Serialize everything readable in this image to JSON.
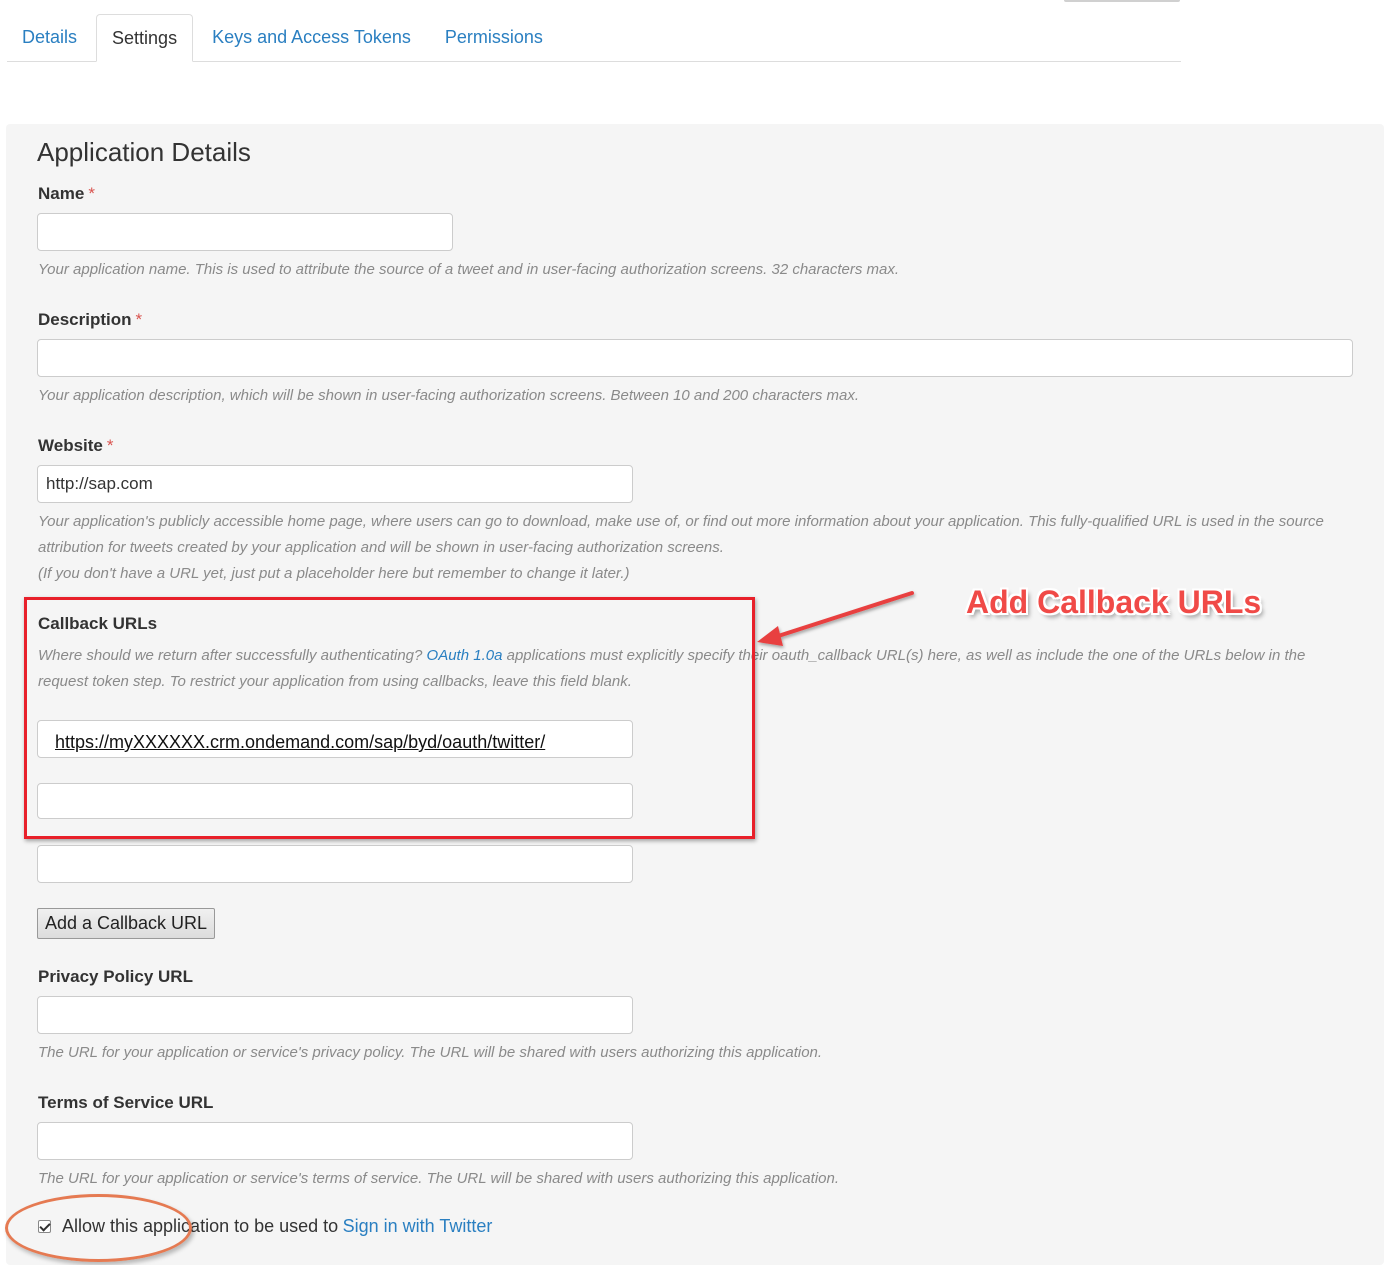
{
  "tabs": [
    {
      "label": "Details",
      "active": false
    },
    {
      "label": "Settings",
      "active": true
    },
    {
      "label": "Keys and Access Tokens",
      "active": false
    },
    {
      "label": "Permissions",
      "active": false
    }
  ],
  "section_title": "Application Details",
  "required_marker": "*",
  "name": {
    "label": "Name",
    "value": "",
    "help": "Your application name. This is used to attribute the source of a tweet and in user-facing authorization screens. 32 characters max."
  },
  "description": {
    "label": "Description",
    "value": "",
    "help": "Your application description, which will be shown in user-facing authorization screens. Between 10 and 200 characters max."
  },
  "website": {
    "label": "Website",
    "value": "http://sap.com",
    "help_line1": "Your application's publicly accessible home page, where users can go to download, make use of, or find out more information about your application. This fully-qualified URL is used in the source",
    "help_line2": "attribution for tweets created by your application and will be shown in user-facing authorization screens.",
    "help_line3": "(If you don't have a URL yet, just put a placeholder here but remember to change it later.)"
  },
  "callback": {
    "label": "Callback URLs",
    "help_pre": "Where should we return after successfully authenticating?",
    "help_link": "OAuth 1.0a",
    "help_post": "applications must explicitly specify their oauth_callback URL(s) here, as well as include the one of the URLs below in the",
    "help_line2": "request token step. To restrict your application from using callbacks, leave this field blank.",
    "url_1": "https://myXXXXXX.crm.ondemand.com/sap/byd/oauth/twitter/",
    "url_2": "",
    "url_3": "",
    "add_button": "Add a Callback URL"
  },
  "privacy": {
    "label": "Privacy Policy URL",
    "value": "",
    "help": "The URL for your application or service's privacy policy. The URL will be shared with users authorizing this application."
  },
  "terms": {
    "label": "Terms of Service URL",
    "value": "",
    "help": "The URL for your application or service's terms of service. The URL will be shared with users authorizing this application."
  },
  "signin": {
    "checked": true,
    "text": "Allow this application to be used to",
    "link": "Sign in with Twitter"
  },
  "annotation": {
    "text": "Add Callback URLs",
    "box_color": "#e8202a",
    "ellipse_color": "#e57a52"
  },
  "colors": {
    "link": "#2a7fc1",
    "panel_bg": "#f5f5f5",
    "required": "#d9534f"
  }
}
